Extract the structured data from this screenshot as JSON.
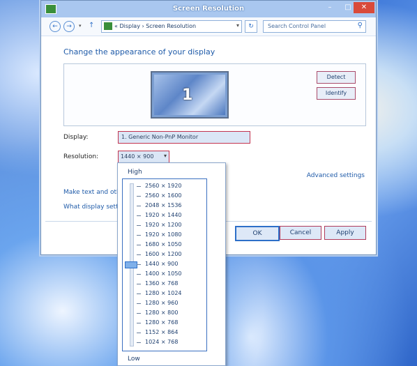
{
  "window": {
    "title": "Screen Resolution",
    "controls": {
      "minimize": "–",
      "maximize": "□",
      "close": "✕"
    }
  },
  "navbar": {
    "back_icon": "back-arrow-icon",
    "forward_icon": "forward-arrow-icon",
    "up_icon": "up-arrow-icon",
    "breadcrumb": "«  Display  ›  Screen Resolution",
    "search_placeholder": "Search Control Panel"
  },
  "main": {
    "heading": "Change the appearance of your display",
    "monitor_number": "1",
    "detect_label": "Detect",
    "identify_label": "Identify",
    "display_label": "Display:",
    "display_value": "1. Generic Non-PnP Monitor",
    "resolution_label": "Resolution:",
    "resolution_value": "1440 × 900",
    "advanced_link": "Advanced settings",
    "make_text_link": "Make text and other items larger or smaller",
    "what_settings_link": "What display settings should I choose?"
  },
  "buttons": {
    "ok": "OK",
    "cancel": "Cancel",
    "apply": "Apply"
  },
  "resolution_dropdown": {
    "high_label": "High",
    "low_label": "Low",
    "selected": "1440 × 900",
    "options": [
      "2560 × 1920",
      "2560 × 1600",
      "2048 × 1536",
      "1920 × 1440",
      "1920 × 1200",
      "1920 × 1080",
      "1680 × 1050",
      "1600 × 1200",
      "1440 × 900",
      "1400 × 1050",
      "1360 × 768",
      "1280 × 1024",
      "1280 × 960",
      "1280 × 800",
      "1280 × 768",
      "1152 × 864",
      "1024 × 768"
    ]
  },
  "colors": {
    "accent": "#1e5aa8",
    "title_bar": "#a9c7ef",
    "close_button": "#d94a3a"
  }
}
